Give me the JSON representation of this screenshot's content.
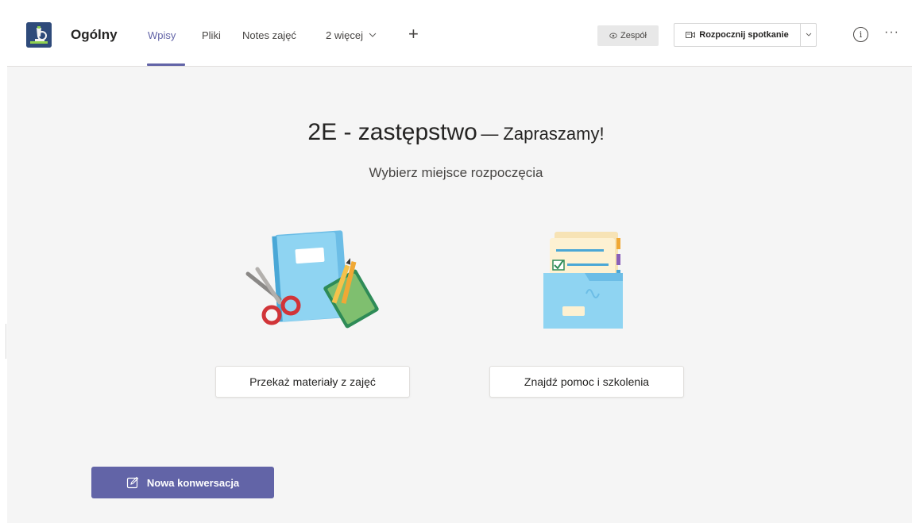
{
  "header": {
    "channel_name": "Ogólny",
    "tabs": [
      {
        "label": "Wpisy",
        "active": true
      },
      {
        "label": "Pliki",
        "active": false
      },
      {
        "label": "Notes zajęć",
        "active": false
      },
      {
        "label": "2 więcej",
        "active": false
      }
    ],
    "add_tab_symbol": "+",
    "team_button": "Zespół",
    "meet_button": "Rozpocznij spotkanie",
    "info_symbol": "i",
    "more_symbol": "···"
  },
  "welcome": {
    "team_name": "2E - zastępstwo",
    "greeting": "— Zapraszamy!",
    "subtitle": "Wybierz miejsce rozpoczęcia"
  },
  "actions": [
    {
      "label": "Przekaż materiały z zajęć",
      "icon": "notebook-scissors-illustration"
    },
    {
      "label": "Znajdź pomoc i szkolenia",
      "icon": "folder-documents-illustration"
    }
  ],
  "compose": {
    "new_conversation_label": "Nowa konwersacja",
    "icon": "compose-icon"
  },
  "colors": {
    "accent": "#6264a7",
    "background": "#f5f5f5",
    "header": "#ffffff"
  }
}
